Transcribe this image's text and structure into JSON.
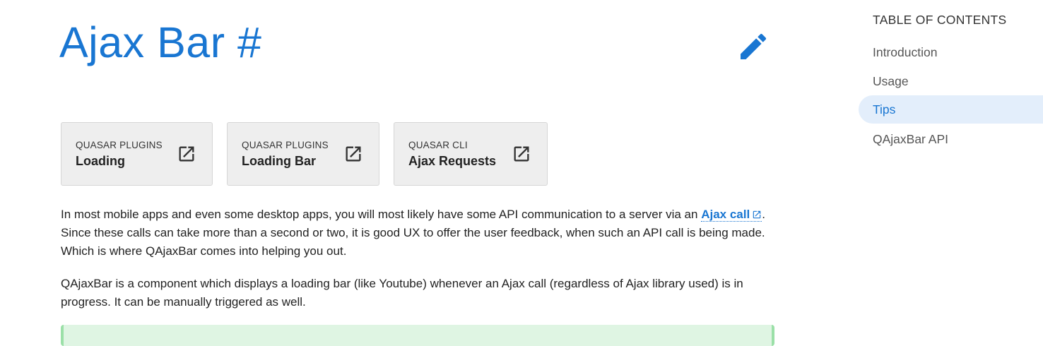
{
  "page": {
    "title": "Ajax Bar",
    "anchor": "#",
    "edit_icon": "pencil-icon",
    "accent_color": "#1976d2"
  },
  "cards": [
    {
      "kicker": "QUASAR PLUGINS",
      "title": "Loading",
      "icon": "open-in-new-icon"
    },
    {
      "kicker": "QUASAR PLUGINS",
      "title": "Loading Bar",
      "icon": "open-in-new-icon"
    },
    {
      "kicker": "QUASAR CLI",
      "title": "Ajax Requests",
      "icon": "open-in-new-icon"
    }
  ],
  "intro": {
    "p1_before": "In most mobile apps and even some desktop apps, you will most likely have some API communication to a server via an",
    "p1_link": "Ajax call",
    "p1_after": ". Since these calls can take more than a second or two, it is good UX to offer the user feedback, when such an API call is being made. Which is where QAjaxBar comes into helping you out.",
    "p2": "QAjaxBar is a component which displays a loading bar (like Youtube) whenever an Ajax call (regardless of Ajax library used) is in progress. It can be manually triggered as well."
  },
  "toc": {
    "title": "TABLE OF CONTENTS",
    "items": [
      {
        "label": "Introduction"
      },
      {
        "label": "Usage"
      },
      {
        "label": "Tips",
        "active": true
      },
      {
        "label": "QAjaxBar API"
      }
    ]
  },
  "colors": {
    "tip_background": "#dff5e3",
    "tip_border": "#9be0a8",
    "toc_active_bg": "#e3eefb"
  }
}
